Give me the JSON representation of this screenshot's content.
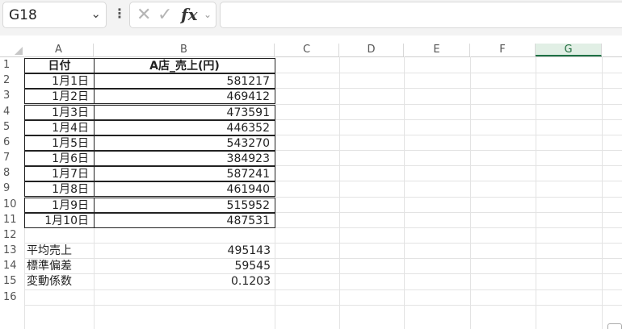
{
  "namebox": {
    "value": "G18",
    "dropdown_icon": "chevron-down-icon"
  },
  "formula_bar": {
    "cancel_icon": "x-icon",
    "enter_icon": "check-icon",
    "fx_label": "fx",
    "formula": ""
  },
  "columns": [
    "A",
    "B",
    "C",
    "D",
    "E",
    "F",
    "G"
  ],
  "selected_column": "G",
  "rows": [
    "1",
    "2",
    "3",
    "4",
    "5",
    "6",
    "7",
    "8",
    "9",
    "10",
    "11",
    "12",
    "13",
    "14",
    "15",
    "16"
  ],
  "sheet": {
    "header": {
      "a": "日付",
      "b": "A店_売上(円)"
    },
    "data": [
      {
        "a": "1月1日",
        "b": "581217"
      },
      {
        "a": "1月2日",
        "b": "469412"
      },
      {
        "a": "1月3日",
        "b": "473591"
      },
      {
        "a": "1月4日",
        "b": "446352"
      },
      {
        "a": "1月5日",
        "b": "543270"
      },
      {
        "a": "1月6日",
        "b": "384923"
      },
      {
        "a": "1月7日",
        "b": "587241"
      },
      {
        "a": "1月8日",
        "b": "461940"
      },
      {
        "a": "1月9日",
        "b": "515952"
      },
      {
        "a": "1月10日",
        "b": "487531"
      }
    ],
    "stats": [
      {
        "a": "平均売上",
        "b": "495143"
      },
      {
        "a": "標準偏差",
        "b": "59545"
      },
      {
        "a": "変動係数",
        "b": "0.1203"
      }
    ]
  }
}
